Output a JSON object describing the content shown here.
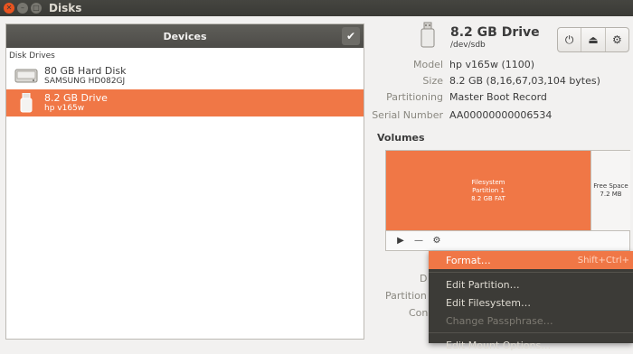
{
  "window": {
    "title": "Disks"
  },
  "devices_panel": {
    "header": "Devices",
    "section_label": "Disk Drives",
    "drives": [
      {
        "name": "80 GB Hard Disk",
        "sub": "SAMSUNG HD082GJ"
      },
      {
        "name": "8.2 GB Drive",
        "sub": "hp v165w"
      }
    ]
  },
  "device": {
    "name": "8.2 GB Drive",
    "path": "/dev/sdb",
    "properties": [
      {
        "label": "Model",
        "value": "hp v165w (1100)"
      },
      {
        "label": "Size",
        "value": "8.2 GB (8,16,67,03,104 bytes)"
      },
      {
        "label": "Partitioning",
        "value": "Master Boot Record"
      },
      {
        "label": "Serial Number",
        "value": "AA00000000006534"
      }
    ]
  },
  "volumes": {
    "title": "Volumes",
    "partition": {
      "line1": "Filesystem",
      "line2": "Partition 1",
      "line3": "8.2 GB FAT"
    },
    "free": {
      "line1": "Free Space",
      "line2": "7.2 MB"
    }
  },
  "background_labels": {
    "d": "D",
    "partition": "Partition",
    "con": "Con"
  },
  "context_menu": {
    "items": [
      {
        "label": "Format…",
        "accel": "Shift+Ctrl+"
      },
      {
        "label": "Edit Partition…"
      },
      {
        "label": "Edit Filesystem…"
      },
      {
        "label": "Change Passphrase…"
      },
      {
        "label": "Edit Mount Options…"
      }
    ]
  },
  "colors": {
    "accent": "#f07746",
    "titlebar": "#3a3a36",
    "menu_bg": "#3c3b37"
  }
}
